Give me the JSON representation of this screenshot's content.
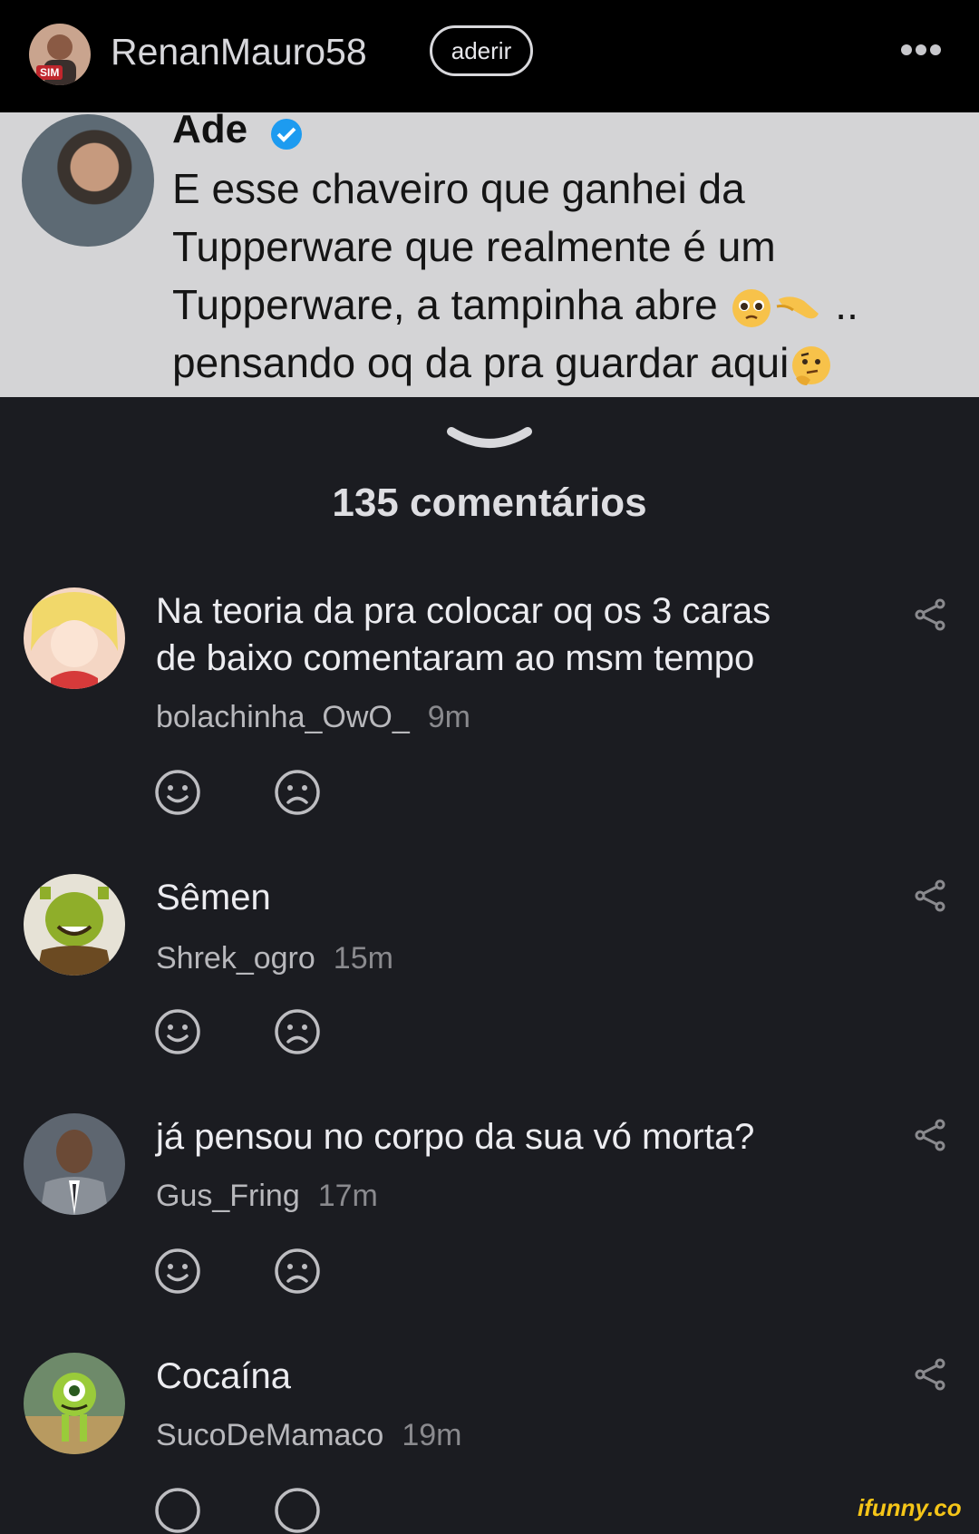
{
  "header": {
    "username": "RenanMauro58",
    "avatar_badge": "SIM",
    "join_label": "aderir",
    "more_icon": "more-dots-icon"
  },
  "tweet": {
    "author": "Ade",
    "verified_icon": "verified-badge-icon",
    "line1": "E esse chaveiro que ganhei da",
    "line2": "Tupperware que realmente é um",
    "line3_a": "Tupperware, a tampinha abre ",
    "line3_b": " ..",
    "line4": "pensando oq da pra guardar aqui",
    "emojis": [
      "pleading-face-emoji",
      "pinching-hand-emoji",
      "thinking-face-emoji"
    ]
  },
  "comments_header": "135 comentários",
  "comments": [
    {
      "text_line1": "Na teoria da pra colocar oq os 3 caras",
      "text_line2": "de baixo comentaram ao msm tempo",
      "user": "bolachinha_OwO_",
      "time": "9m"
    },
    {
      "text_line1": "Sêmen",
      "user": "Shrek_ogro",
      "time": "15m"
    },
    {
      "text_line1": "já pensou no corpo da sua vó morta?",
      "user": "Gus_Fring",
      "time": "17m"
    },
    {
      "text_line1": "Cocaína",
      "user": "SucoDeMamaco",
      "time": "19m"
    }
  ],
  "watermark": "ifunny.co",
  "colors": {
    "background": "#1b1c21",
    "topbar": "#000000",
    "tweet_bg": "#d4d4d6",
    "verified": "#1d9bf0",
    "watermark": "#f5c518"
  }
}
